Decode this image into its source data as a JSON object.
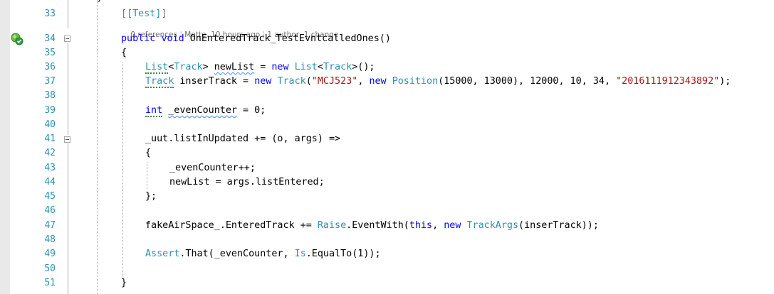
{
  "editor": {
    "codelens": {
      "references": "0 references",
      "author_time": "Mette, 10 hours ago",
      "changes": "1 author, 1 change"
    },
    "lines": [
      {
        "num": "33",
        "text": "[Test]"
      },
      {
        "num": "34",
        "kw1": "public",
        "kw2": "void",
        "text": " OnEnteredTrack_TestEvntcalledOnes()"
      },
      {
        "num": "35",
        "text": "{"
      },
      {
        "num": "36",
        "t1": "List",
        "t2": "<",
        "t3": "Track",
        "t4": "> ",
        "t5": "newList",
        "t6": " = ",
        "t7": "new",
        "t8": " ",
        "t9": "List",
        "t10": "<",
        "t11": "Track",
        "t12": ">();"
      },
      {
        "num": "37",
        "t1": "Track",
        "t2": " inserTrack = ",
        "t3": "new",
        "t4": " ",
        "t5": "Track",
        "t6": "(",
        "t7": "\"MCJ523\"",
        "t8": ", ",
        "t9": "new",
        "t10": " ",
        "t11": "Position",
        "t12": "(15000, 13000), 12000, 10, 34, ",
        "t13": "\"2016111912343892\"",
        "t14": ");"
      },
      {
        "num": "38"
      },
      {
        "num": "39",
        "t1": "int",
        "t2": " ",
        "t3": "_evenCounter",
        "t4": " = 0;"
      },
      {
        "num": "40"
      },
      {
        "num": "41",
        "text": "_uut.listInUpdated += (o, args) =>"
      },
      {
        "num": "42",
        "text": "{"
      },
      {
        "num": "43",
        "text": "_evenCounter++;"
      },
      {
        "num": "44",
        "text": "newList = args.listEntered;"
      },
      {
        "num": "45",
        "text": "};"
      },
      {
        "num": "46"
      },
      {
        "num": "47",
        "t1": "fakeAirSpace_.EnteredTrack += ",
        "t2": "Raise",
        "t3": ".EventWith(",
        "t4": "this",
        "t5": ", ",
        "t6": "new",
        "t7": " ",
        "t8": "TrackArgs",
        "t9": "(inserTrack));"
      },
      {
        "num": "48"
      },
      {
        "num": "49",
        "t1": "Assert",
        "t2": ".That(_evenCounter, ",
        "t3": "Is",
        "t4": ".EqualTo(1));"
      },
      {
        "num": "50"
      },
      {
        "num": "51",
        "text": "}"
      }
    ]
  },
  "icons": {
    "test_status": "test-passed-icon"
  }
}
